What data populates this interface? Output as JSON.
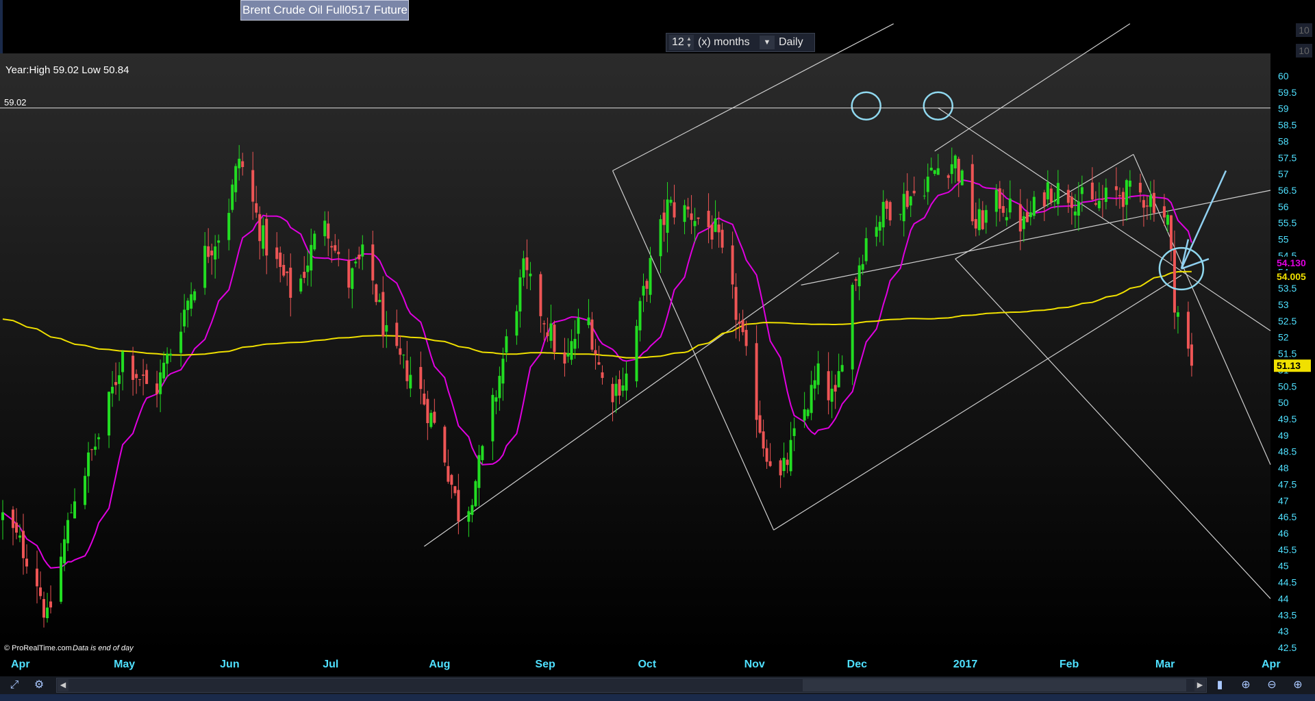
{
  "title": "Brent Crude Oil Full0517 Future",
  "period": {
    "value": "12",
    "unit": "(x) months",
    "frequency": "Daily"
  },
  "side_mini": [
    "10",
    "10"
  ],
  "chart_data": {
    "type": "candlestick",
    "info_label": "Year:High 59.02 Low 50.84",
    "high_line_label": "59.02",
    "high_line_value": 59.02,
    "y_ticks": [
      "42.5",
      "43",
      "43.5",
      "44",
      "44.5",
      "45",
      "45.5",
      "46",
      "46.5",
      "47",
      "47.5",
      "48",
      "48.5",
      "49",
      "49.5",
      "50",
      "50.5",
      "51",
      "51.5",
      "52",
      "52.5",
      "53",
      "53.5",
      "54",
      "54.5",
      "55",
      "55.5",
      "56",
      "56.5",
      "57",
      "57.5",
      "58",
      "58.5",
      "59",
      "59.5",
      "60"
    ],
    "ylim": [
      42.5,
      60
    ],
    "x_labels": [
      {
        "label": "Apr",
        "date": "2016-04-01"
      },
      {
        "label": "May",
        "date": "2016-05-01"
      },
      {
        "label": "Jun",
        "date": "2016-06-01"
      },
      {
        "label": "Jul",
        "date": "2016-07-01"
      },
      {
        "label": "Aug",
        "date": "2016-08-01"
      },
      {
        "label": "Sep",
        "date": "2016-09-01"
      },
      {
        "label": "Oct",
        "date": "2016-10-01"
      },
      {
        "label": "Nov",
        "date": "2016-11-01"
      },
      {
        "label": "Dec",
        "date": "2016-12-01"
      },
      {
        "label": "2017",
        "date": "2017-01-01"
      },
      {
        "label": "Feb",
        "date": "2017-02-01"
      },
      {
        "label": "Mar",
        "date": "2017-03-01"
      },
      {
        "label": "Apr",
        "date": "2017-04-01"
      }
    ],
    "xlim": [
      "2016-04-01",
      "2017-04-06"
    ],
    "close_path": [
      {
        "date": "2016-04-01",
        "value": 46.5
      },
      {
        "date": "2016-04-10",
        "value": 45.0
      },
      {
        "date": "2016-04-14",
        "value": 43.3
      },
      {
        "date": "2016-04-22",
        "value": 47.2
      },
      {
        "date": "2016-04-30",
        "value": 49.2
      },
      {
        "date": "2016-05-06",
        "value": 51.5
      },
      {
        "date": "2016-05-15",
        "value": 50.2
      },
      {
        "date": "2016-05-22",
        "value": 52.2
      },
      {
        "date": "2016-05-29",
        "value": 54.4
      },
      {
        "date": "2016-06-05",
        "value": 55.5
      },
      {
        "date": "2016-06-09",
        "value": 57.5
      },
      {
        "date": "2016-06-16",
        "value": 55.0
      },
      {
        "date": "2016-06-25",
        "value": 53.2
      },
      {
        "date": "2016-07-04",
        "value": 55.8
      },
      {
        "date": "2016-07-10",
        "value": 53.5
      },
      {
        "date": "2016-07-16",
        "value": 54.6
      },
      {
        "date": "2016-07-23",
        "value": 51.5
      },
      {
        "date": "2016-07-30",
        "value": 50.8
      },
      {
        "date": "2016-08-07",
        "value": 48.8
      },
      {
        "date": "2016-08-13",
        "value": 46.2
      },
      {
        "date": "2016-08-19",
        "value": 48.4
      },
      {
        "date": "2016-08-26",
        "value": 51.8
      },
      {
        "date": "2016-08-31",
        "value": 54.0
      },
      {
        "date": "2016-09-06",
        "value": 52.6
      },
      {
        "date": "2016-09-12",
        "value": 51.0
      },
      {
        "date": "2016-09-18",
        "value": 53.0
      },
      {
        "date": "2016-09-24",
        "value": 50.2
      },
      {
        "date": "2016-09-30",
        "value": 50.8
      },
      {
        "date": "2016-10-06",
        "value": 53.8
      },
      {
        "date": "2016-10-12",
        "value": 56.0
      },
      {
        "date": "2016-10-19",
        "value": 55.8
      },
      {
        "date": "2016-10-26",
        "value": 55.2
      },
      {
        "date": "2016-11-01",
        "value": 52.8
      },
      {
        "date": "2016-11-09",
        "value": 48.8
      },
      {
        "date": "2016-11-14",
        "value": 47.6
      },
      {
        "date": "2016-11-20",
        "value": 49.5
      },
      {
        "date": "2016-11-25",
        "value": 50.8
      },
      {
        "date": "2016-11-30",
        "value": 50.0
      },
      {
        "date": "2016-12-04",
        "value": 53.2
      },
      {
        "date": "2016-12-10",
        "value": 55.4
      },
      {
        "date": "2016-12-16",
        "value": 56.0
      },
      {
        "date": "2016-12-23",
        "value": 56.4
      },
      {
        "date": "2016-12-30",
        "value": 57.2
      },
      {
        "date": "2017-01-04",
        "value": 57.4
      },
      {
        "date": "2017-01-10",
        "value": 55.4
      },
      {
        "date": "2017-01-17",
        "value": 56.2
      },
      {
        "date": "2017-01-24",
        "value": 55.4
      },
      {
        "date": "2017-01-31",
        "value": 56.6
      },
      {
        "date": "2017-02-06",
        "value": 56.4
      },
      {
        "date": "2017-02-13",
        "value": 56.0
      },
      {
        "date": "2017-02-20",
        "value": 56.4
      },
      {
        "date": "2017-02-26",
        "value": 56.4
      },
      {
        "date": "2017-03-03",
        "value": 56.2
      },
      {
        "date": "2017-03-07",
        "value": 55.6
      },
      {
        "date": "2017-03-09",
        "value": 53.2
      },
      {
        "date": "2017-03-13",
        "value": 51.5
      },
      {
        "date": "2017-03-14",
        "value": 51.13
      }
    ],
    "series": [
      {
        "label": "54.130",
        "color": "#e000e0",
        "period_days": 20
      },
      {
        "label": "54.005",
        "color": "#f0e000",
        "period_days": 200
      }
    ],
    "last_price": "51.13",
    "annotations": {
      "circles": [
        {
          "date": "2016-12-09",
          "value": 59.02
        },
        {
          "date": "2016-12-30",
          "value": 59.02
        },
        {
          "date": "2017-03-11",
          "value": 54.1
        }
      ],
      "trendlines": [
        {
          "from": {
            "date": "2016-08-02",
            "value": 45.6
          },
          "to": {
            "date": "2016-12-01",
            "value": 54.6
          },
          "color": "#cfcfcf"
        },
        {
          "from": {
            "date": "2016-09-26",
            "value": 57.1
          },
          "to": {
            "date": "2016-11-12",
            "value": 46.1
          },
          "color": "#cfcfcf"
        },
        {
          "from": {
            "date": "2016-09-26",
            "value": 57.1
          },
          "to": {
            "date": "2016-12-17",
            "value": 61.6
          },
          "color": "#cfcfcf"
        },
        {
          "from": {
            "date": "2016-11-12",
            "value": 46.1
          },
          "to": {
            "date": "2017-03-11",
            "value": 53.9
          },
          "color": "#cfcfcf"
        },
        {
          "from": {
            "date": "2016-11-20",
            "value": 53.6
          },
          "to": {
            "date": "2017-04-06",
            "value": 56.5
          },
          "color": "#cfcfcf"
        },
        {
          "from": {
            "date": "2016-12-29",
            "value": 57.7
          },
          "to": {
            "date": "2017-02-24",
            "value": 61.6
          },
          "color": "#cfcfcf"
        },
        {
          "from": {
            "date": "2016-12-30",
            "value": 59.02
          },
          "to": {
            "date": "2017-04-06",
            "value": 52.2
          },
          "color": "#cfcfcf"
        },
        {
          "from": {
            "date": "2017-01-04",
            "value": 54.4
          },
          "to": {
            "date": "2017-04-06",
            "value": 44.0
          },
          "color": "#cfcfcf"
        },
        {
          "from": {
            "date": "2017-01-04",
            "value": 54.4
          },
          "to": {
            "date": "2017-02-25",
            "value": 57.6
          },
          "color": "#cfcfcf"
        },
        {
          "from": {
            "date": "2017-02-25",
            "value": 57.6
          },
          "to": {
            "date": "2017-04-06",
            "value": 48.1
          },
          "color": "#cfcfcf"
        },
        {
          "from": {
            "date": "2017-03-11",
            "value": 54.1
          },
          "to": {
            "date": "2017-03-24",
            "value": 57.1
          },
          "color": "#90d0f0"
        },
        {
          "from": {
            "date": "2017-03-11",
            "value": 54.1
          },
          "to": {
            "date": "2017-03-13",
            "value": 55.0
          },
          "color": "#90d0f0"
        },
        {
          "from": {
            "date": "2017-03-11",
            "value": 54.1
          },
          "to": {
            "date": "2017-03-19",
            "value": 54.4
          },
          "color": "#90d0f0"
        }
      ]
    },
    "footer": {
      "copyright": "© ProRealTime.com",
      "note": "Data is end of day"
    },
    "colors": {
      "up": "#22dd22",
      "down": "#ee5555",
      "axis_text": "#4fe0ff",
      "grid": "#3a3a3a"
    }
  }
}
